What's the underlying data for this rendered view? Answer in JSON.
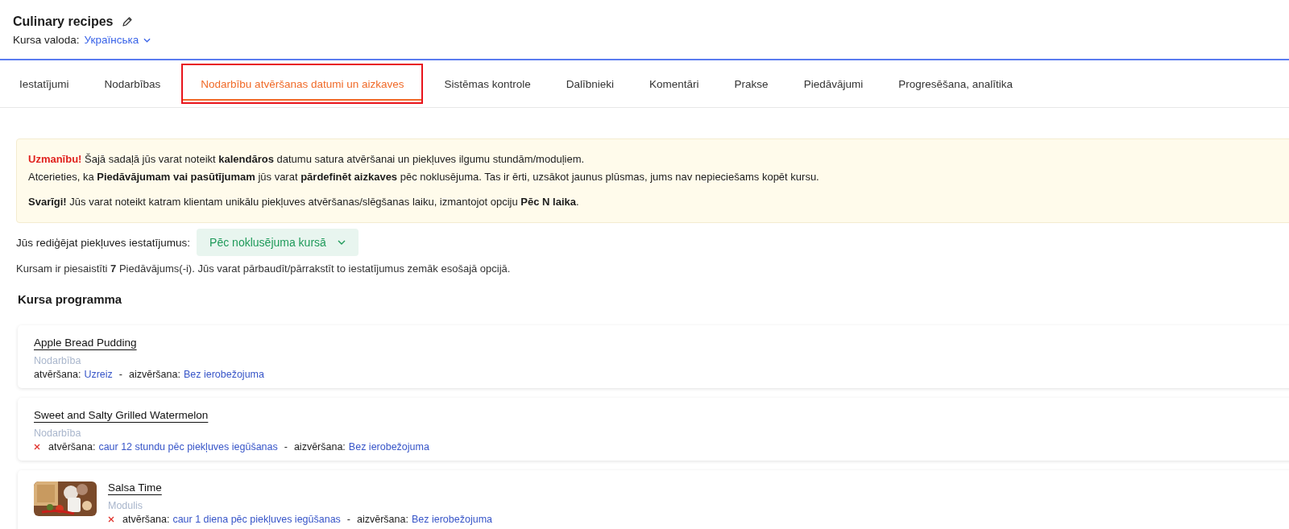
{
  "header": {
    "title": "Culinary recipes",
    "language_label": "Kursa valoda:",
    "language": "Українська"
  },
  "tabs": [
    {
      "label": "Iestatījumi",
      "selected": false,
      "highlighted": false
    },
    {
      "label": "Nodarbības",
      "selected": false,
      "highlighted": false
    },
    {
      "label": "Nodarbību atvēršanas datumi un aizkaves",
      "selected": true,
      "highlighted": true
    },
    {
      "label": "Sistēmas kontrole",
      "selected": false,
      "highlighted": false
    },
    {
      "label": "Dalībnieki",
      "selected": false,
      "highlighted": false
    },
    {
      "label": "Komentāri",
      "selected": false,
      "highlighted": false
    },
    {
      "label": "Prakse",
      "selected": false,
      "highlighted": false
    },
    {
      "label": "Piedāvājumi",
      "selected": false,
      "highlighted": false
    },
    {
      "label": "Progresēšana, analītika",
      "selected": false,
      "highlighted": false
    }
  ],
  "notice": {
    "blocks": [
      {
        "lines": [
          {
            "lead": "Uzmanību!",
            "text": "Šajā sadaļā jūs varat noteikt **kalendāros** datumu satura atvēršanai un piekļuves ilgumu stundām/moduļiem."
          },
          {
            "text": "Atcerieties, ka **Piedāvājumam vai pasūtījumam** jūs varat **pārdefinēt aizkaves** pēc noklusējuma. Tas ir ērti, uzsākot jaunus plūsmas, jums nav nepieciešams kopēt kursu."
          }
        ]
      },
      {
        "lines": [
          {
            "text": "**Svarīgi!** Jūs varat noteikt katram klientam unikālu piekļuves atvēršanas/slēgšanas laiku, izmantojot opciju **Pēc N laika**."
          }
        ]
      }
    ]
  },
  "access": {
    "label": "Jūs rediģējat piekļuves iestatījumus:",
    "value": "Pēc noklusējuma kursā"
  },
  "offers_note": "Kursam ir piesaistīti **7** Piedāvājums(-i). Jūs varat pārbaudīt/pārrakstīt to iestatījumus zemāk esošajā opcijā.",
  "program": {
    "title": "Kursa programma",
    "items": [
      {
        "title": "Apple Bread Pudding",
        "type": "Nodarbība",
        "restricted": false,
        "open_label": "atvēršana:",
        "open_value": "Uzreiz",
        "separator": "-",
        "close_label": "aizvēršana:",
        "close_value": "Bez ierobežojuma"
      },
      {
        "title": "Sweet and Salty Grilled Watermelon",
        "type": "Nodarbība",
        "restricted": true,
        "open_label": "atvēršana:",
        "open_value": "caur 12 stundu pēc piekļuves iegūšanas",
        "separator": "-",
        "close_label": "aizvēršana:",
        "close_value": "Bez ierobežojuma"
      },
      {
        "title": "Salsa Time",
        "type": "Modulis",
        "kind": "picture",
        "restricted": true,
        "open_label": "atvēršana:",
        "open_value": "caur 1 diena pēc piekļuves iegūšanas",
        "separator": "-",
        "close_label": "aizvēršana:",
        "close_value": "Bez ierobežojuma"
      }
    ]
  }
}
